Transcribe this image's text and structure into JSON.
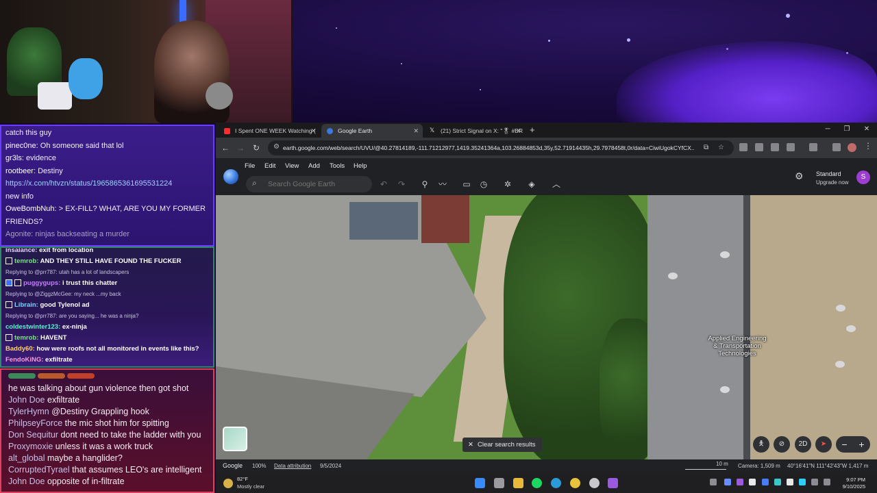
{
  "chat1": {
    "lines": [
      {
        "user": "",
        "text": "catch this guy"
      },
      {
        "user": "pinec0ne:",
        "text": " Oh someone said that lol"
      },
      {
        "user": "gr3ls:",
        "text": " evidence"
      },
      {
        "user": "rootbeer:",
        "text": " Destiny"
      },
      {
        "user": "",
        "text": "https://x.com/htvzn/status/1965865361695531224"
      },
      {
        "user": "",
        "text": "new info"
      },
      {
        "user": "OweBombNuh:",
        "text": " > EX-FILL? WHAT, ARE YOU MY FORMER"
      },
      {
        "user": "",
        "text": "FRIENDS?"
      },
      {
        "user": "Agonite:",
        "text": " ninjas backseating a murder"
      }
    ]
  },
  "chat2": {
    "lines": [
      {
        "user": "insaiance:",
        "text": " exit from location",
        "reply": false
      },
      {
        "user": "temrob:",
        "text": " AND THEY STILL HAVE FOUND THE FUCKER",
        "reply": false
      },
      {
        "user": "",
        "text": "Replying to @prr787: utah has a lot of landscapers",
        "reply": true
      },
      {
        "user": "puggygups:",
        "text": " i trust this chatter",
        "reply": false
      },
      {
        "user": "",
        "text": "Replying to @ZiggzMcGee: my neck ...my back",
        "reply": true
      },
      {
        "user": "Librain:",
        "text": " good Tylenol ad",
        "reply": false
      },
      {
        "user": "",
        "text": "Replying to @prr787: are you saying... he was a ninja?",
        "reply": true
      },
      {
        "user": "coldestwinter123:",
        "text": " ex-ninja",
        "reply": false
      },
      {
        "user": "temrob:",
        "text": " HAVENT",
        "reply": false
      },
      {
        "user": "Baddy60:",
        "text": " how were roofs not all monitored in events like this?",
        "reply": false
      },
      {
        "user": "FendoKiNG:",
        "text": " exfiltrate",
        "reply": false
      }
    ]
  },
  "chat3": {
    "lines": [
      {
        "user": "",
        "text": "he was talking about gun violence then got shot"
      },
      {
        "user": "John Doe",
        "text": " exfiltrate"
      },
      {
        "user": "TylerHymn",
        "text": " @Destiny Grappling hook"
      },
      {
        "user": "PhilpseyForce",
        "text": " the mic shot him for spitting"
      },
      {
        "user": "Don Sequitur",
        "text": " dont need to take the ladder with you"
      },
      {
        "user": "Proxymoxie",
        "text": " unless it was a work truck"
      },
      {
        "user": "alt_global",
        "text": " maybe a hanglider?"
      },
      {
        "user": "CorruptedTyrael",
        "text": " that assumes LEO's are intelligent"
      },
      {
        "user": "John Doe",
        "text": " opposite of in-filtrate"
      }
    ]
  },
  "browser": {
    "tabs": [
      {
        "title": "I Spent ONE WEEK Watching (",
        "favicon_color": "#ff2a2a"
      },
      {
        "title": "Google Earth",
        "favicon_color": "#3a7ae0"
      },
      {
        "title": "(21) Strict Signal on X: \"🎖 #BR",
        "favicon_color": "#e8e8ea"
      }
    ],
    "new_tab": "+",
    "url": "earth.google.com/web/search/UVU/@40.27814189,-111.71212977,1419.35241364a,103.26884853d,35y,52.71914435h,29.7978458t,0r/data=CiwiUgokCYfCX..."
  },
  "earth": {
    "menu": [
      "File",
      "Edit",
      "View",
      "Add",
      "Tools",
      "Help"
    ],
    "search_placeholder": "Search Google Earth",
    "plan": "Standard",
    "upgrade": "Upgrade now",
    "avatar_letter": "S",
    "place_label": "Applied Engineering & Transportation Technologies",
    "clear_search": "Clear search results",
    "view_mode": "2D",
    "status": {
      "brand": "Google",
      "zoom": "100%",
      "attribution": "Data attribution",
      "imagery_date": "9/5/2024",
      "scale": "10 m",
      "camera": "Camera: 1,509 m",
      "coords": "40°16'41\"N 111°42'43\"W 1,417 m"
    }
  },
  "taskbar": {
    "temp": "82°F",
    "weather": "Mostly clear",
    "time": "9:07 PM",
    "date": "9/10/2025"
  },
  "colors": {
    "accent": "#6a3cff",
    "chat2_border": "#2e8a6a",
    "chat3_border": "#e04060",
    "avatar": "#9c3fd0"
  }
}
